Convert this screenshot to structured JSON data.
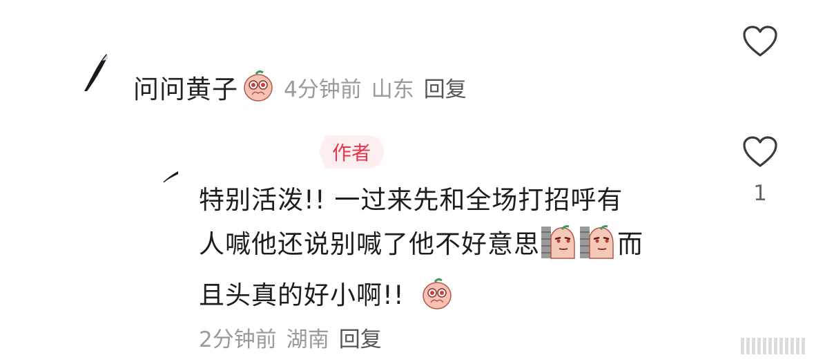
{
  "comment": {
    "username": "问问黄子",
    "time": "4分钟前",
    "location": "山东",
    "reply_label": "回复",
    "like_icon": "heart-outline-icon",
    "emoji": "pleading-emoji"
  },
  "reply": {
    "author_badge": "作者",
    "text_line_1": "特别活泼!!  一过来先和全场打招呼有",
    "text_line_2": "人喊他还说别喊了他不好意思",
    "text_line_3": "而",
    "text_line_4": "且头真的好小啊!!",
    "time": "2分钟前",
    "location": "湖南",
    "reply_label": "回复",
    "like_count": "1",
    "like_icon": "heart-outline-icon",
    "emojis": [
      "shy-peek-emoji",
      "shy-peek-emoji",
      "pleading-emoji"
    ]
  },
  "colors": {
    "author_badge_text": "#e8334d",
    "author_badge_bg": "#fdeff0",
    "meta_text": "#9a9a9a"
  }
}
